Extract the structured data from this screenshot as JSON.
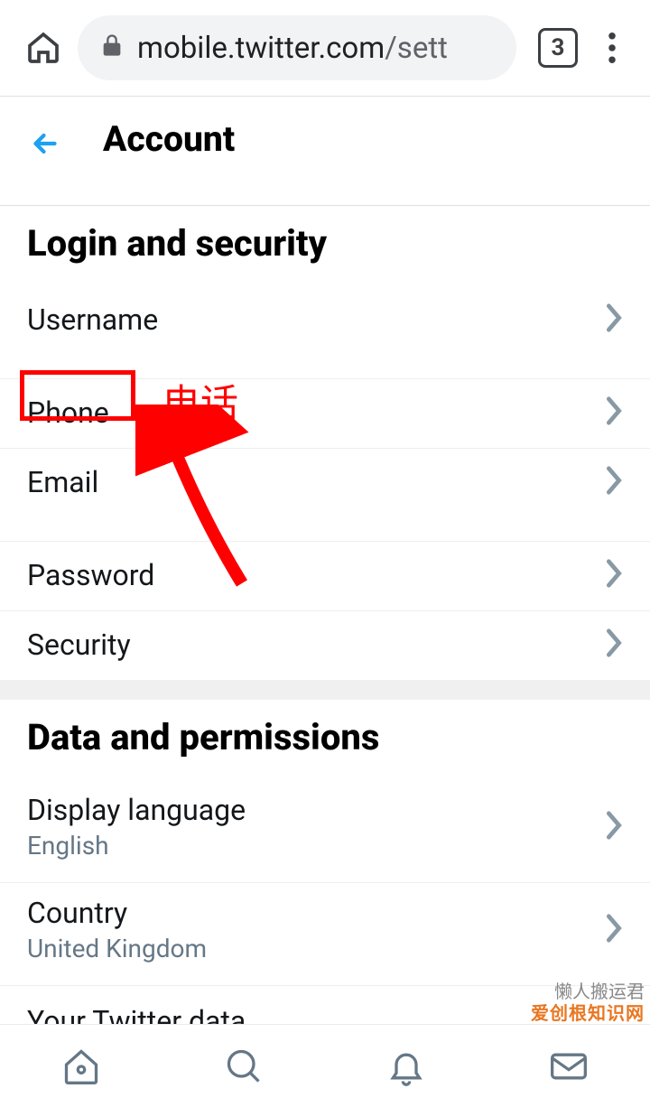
{
  "browser": {
    "url_host": "mobile.twitter.com",
    "url_path": "/sett",
    "tab_count": "3"
  },
  "header": {
    "title": "Account"
  },
  "sections": {
    "login": {
      "title": "Login and security",
      "items": [
        {
          "label": "Username"
        },
        {
          "label": "Phone"
        },
        {
          "label": "Email"
        },
        {
          "label": "Password"
        },
        {
          "label": "Security"
        }
      ]
    },
    "data": {
      "title": "Data and permissions",
      "items": [
        {
          "label": "Display language",
          "sub": "English"
        },
        {
          "label": "Country",
          "sub": "United Kingdom"
        },
        {
          "label": "Your Twitter data"
        }
      ]
    }
  },
  "annotation": {
    "phone_label_cn": "电话"
  },
  "watermark": {
    "line1": "懒人搬运君",
    "line2": "爱创根知识网"
  }
}
